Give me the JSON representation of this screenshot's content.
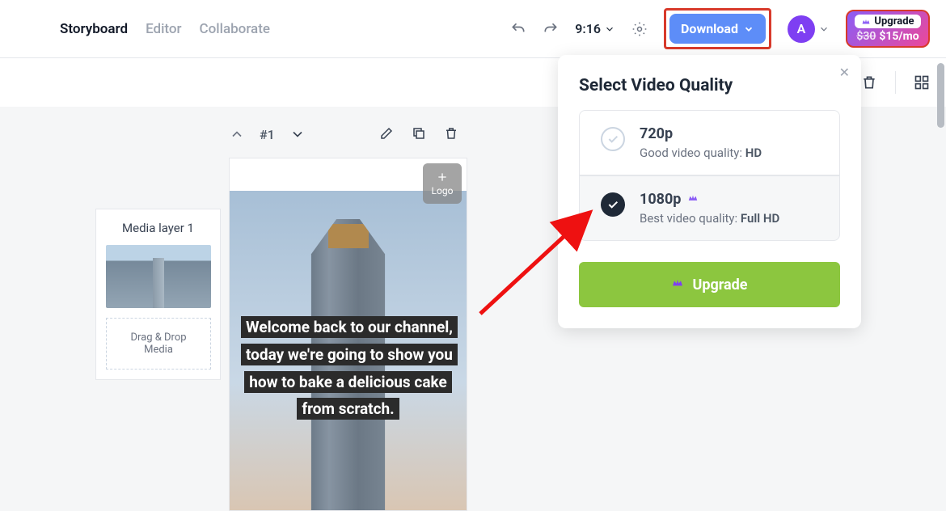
{
  "header": {
    "tabs": [
      {
        "label": "Storyboard",
        "active": true
      },
      {
        "label": "Editor",
        "active": false
      },
      {
        "label": "Collaborate",
        "active": false
      }
    ],
    "timecode": "9:16",
    "download_label": "Download",
    "avatar_initial": "A"
  },
  "upgrade_pill": {
    "label": "Upgrade",
    "old_price": "$30",
    "new_price": "$15/mo"
  },
  "scene_controls": {
    "number": "#1"
  },
  "corner_label": "Logo",
  "media_panel": {
    "title": "Media layer 1",
    "dropzone_line1": "Drag & Drop",
    "dropzone_line2": "Media"
  },
  "caption_text": "Welcome back to our channel, today we're going to show you how to bake a delicious cake from scratch.",
  "popover": {
    "title": "Select Video Quality",
    "options": [
      {
        "name": "720p",
        "desc_prefix": "Good video quality: ",
        "desc_bold": "HD",
        "selected": false,
        "premium": false
      },
      {
        "name": "1080p",
        "desc_prefix": "Best video quality: ",
        "desc_bold": "Full HD",
        "selected": true,
        "premium": true
      }
    ],
    "upgrade_label": "Upgrade"
  }
}
